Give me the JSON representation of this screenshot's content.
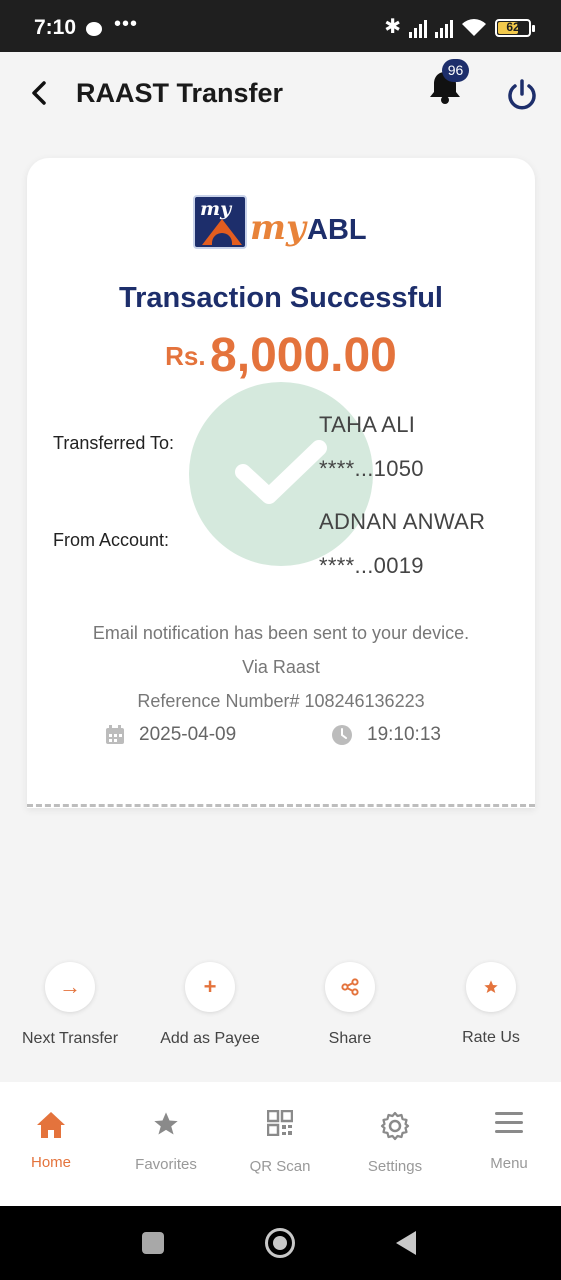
{
  "status_bar": {
    "time": "7:10",
    "dots": "•••",
    "battery": "62"
  },
  "header": {
    "title": "RAAST Transfer",
    "notification_count": "96"
  },
  "logo": {
    "my": "my",
    "brand_my": "my",
    "brand_abl": "ABL"
  },
  "transaction": {
    "title": "Transaction Successful",
    "currency": "Rs.",
    "amount": "8,000.00",
    "transferred_to_label": "Transferred To:",
    "to_name": "TAHA ALI",
    "to_account": "****...1050",
    "from_account_label": "From Account:",
    "from_name": "ADNAN ANWAR",
    "from_account": "****...0019",
    "email_note": "Email notification has been sent to your device.",
    "via": "Via Raast",
    "reference": "Reference Number# 108246136223",
    "date": "2025-04-09",
    "time": "19:10:13"
  },
  "actions": [
    {
      "label": "Next Transfer",
      "icon": "arrow-right-icon"
    },
    {
      "label": "Add as Payee",
      "icon": "plus-icon"
    },
    {
      "label": "Share",
      "icon": "share-icon"
    },
    {
      "label": "Rate Us",
      "icon": "star-icon"
    }
  ],
  "nav": [
    {
      "label": "Home",
      "icon": "home-icon",
      "active": true
    },
    {
      "label": "Favorites",
      "icon": "star-icon"
    },
    {
      "label": "QR Scan",
      "icon": "qr-icon"
    },
    {
      "label": "Settings",
      "icon": "gear-icon"
    },
    {
      "label": "Menu",
      "icon": "menu-icon"
    }
  ],
  "colors": {
    "brand_navy": "#1d2e6b",
    "accent_orange": "#e4733c",
    "success_green": "#d5e9dd"
  }
}
